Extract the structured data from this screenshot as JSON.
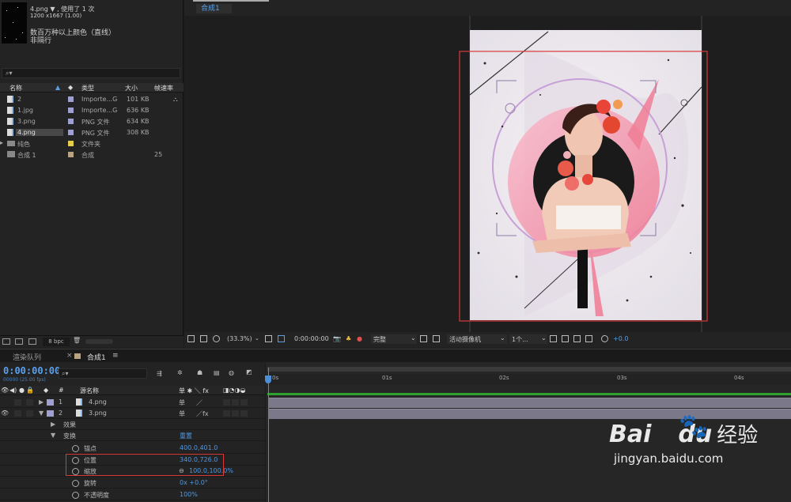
{
  "project": {
    "thumb_info_1": "4.png ▼ , 使用了 1 次",
    "thumb_info_2": "1200 x1667 (1.00)",
    "color_info_1": "数百万种以上颜色（直线）",
    "color_info_2": "非隔行",
    "search_icon": "⌕▾",
    "columns": {
      "name": "名称",
      "type": "类型",
      "size": "大小",
      "fps": "帧速率"
    },
    "items": [
      {
        "name": "2",
        "type": "Importe...G",
        "size": "101 KB",
        "fps": "",
        "label": "#9ea0cf"
      },
      {
        "name": "1.jpg",
        "type": "Importe...G",
        "size": "636 KB",
        "fps": "",
        "label": "#9ea0cf"
      },
      {
        "name": "3.png",
        "type": "PNG 文件",
        "size": "634 KB",
        "fps": "",
        "label": "#9ea0cf"
      },
      {
        "name": "4.png",
        "type": "PNG 文件",
        "size": "308 KB",
        "fps": "",
        "label": "#9ea0cf"
      },
      {
        "name": "纯色",
        "type": "文件夹",
        "size": "",
        "fps": "",
        "label": "#e5cf4a"
      },
      {
        "name": "合成 1",
        "type": "合成",
        "size": "",
        "fps": "25",
        "label": "#b9a482"
      }
    ],
    "bpc": "8 bpc"
  },
  "viewer": {
    "comp_tab": "合成1",
    "zoom": "(33.3%)",
    "time": "0:00:00:00",
    "quality": "完整",
    "camera": "活动摄像机",
    "views": "1个...",
    "exposure": "+0.0"
  },
  "bottom_tabs": {
    "render_queue": "渲染队列",
    "comp_tab": "合成1"
  },
  "timeline": {
    "timecode": "0:00:00:00",
    "fps_line": "00000 (25.00 fps)",
    "header": {
      "num": "#",
      "source": "源名称",
      "switches": "单 ✱ ＼ fx"
    },
    "layers": [
      {
        "num": "1",
        "name": "4.png"
      },
      {
        "num": "2",
        "name": "3.png"
      }
    ],
    "props": {
      "effects": "效果",
      "transform": "变换",
      "reset": "重置",
      "anchor_label": "锚点",
      "anchor_value": "400.0,401.0",
      "position_label": "位置",
      "position_value": "340.0,726.0",
      "scale_label": "缩放",
      "scale_value": "100.0,100.0%",
      "rotation_label": "旋转",
      "rotation_value": "0x +0.0°",
      "opacity_label": "不透明度",
      "opacity_value": "100%"
    },
    "ruler": [
      "0s",
      "01s",
      "02s",
      "03s",
      "04s"
    ]
  },
  "watermark": {
    "brand": "Bai",
    "brand2": "du",
    "cn": "经验",
    "url": "jingyan.baidu.com"
  }
}
